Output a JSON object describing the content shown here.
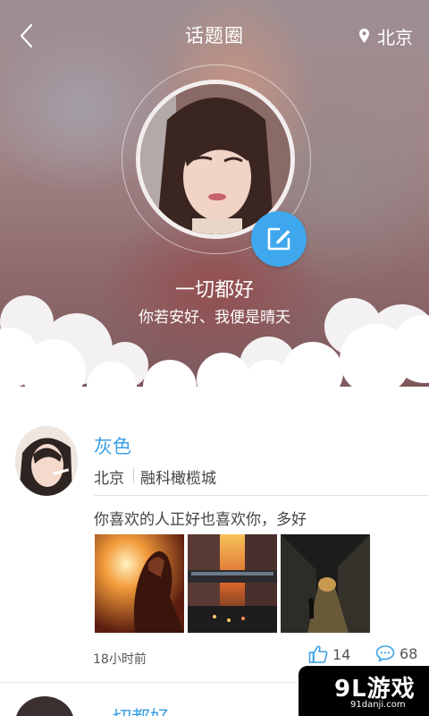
{
  "header": {
    "title": "话题圈",
    "location": "北京"
  },
  "profile": {
    "name": "一切都好",
    "motto": "你若安好、我便是晴天"
  },
  "post": {
    "user": "灰色",
    "city": "北京",
    "place": "融科橄榄城",
    "text": "你喜欢的人正好也喜欢你，多好",
    "time": "18小时前",
    "likes": "14",
    "comments": "68",
    "photos": [
      "photo-sunset-girl",
      "photo-city-street",
      "photo-alley-night"
    ]
  },
  "next_post": {
    "user": "一切都好"
  },
  "watermark": {
    "main": "9L游戏",
    "sub": "91danji.com"
  },
  "colors": {
    "accent": "#3ca0e4",
    "edit_button": "#3fa7ee",
    "text": "#444444"
  },
  "icons": {
    "back": "chevron-left-icon",
    "location": "location-pin-icon",
    "edit": "edit-icon",
    "like": "thumbs-up-icon",
    "comment": "comment-bubble-icon"
  }
}
